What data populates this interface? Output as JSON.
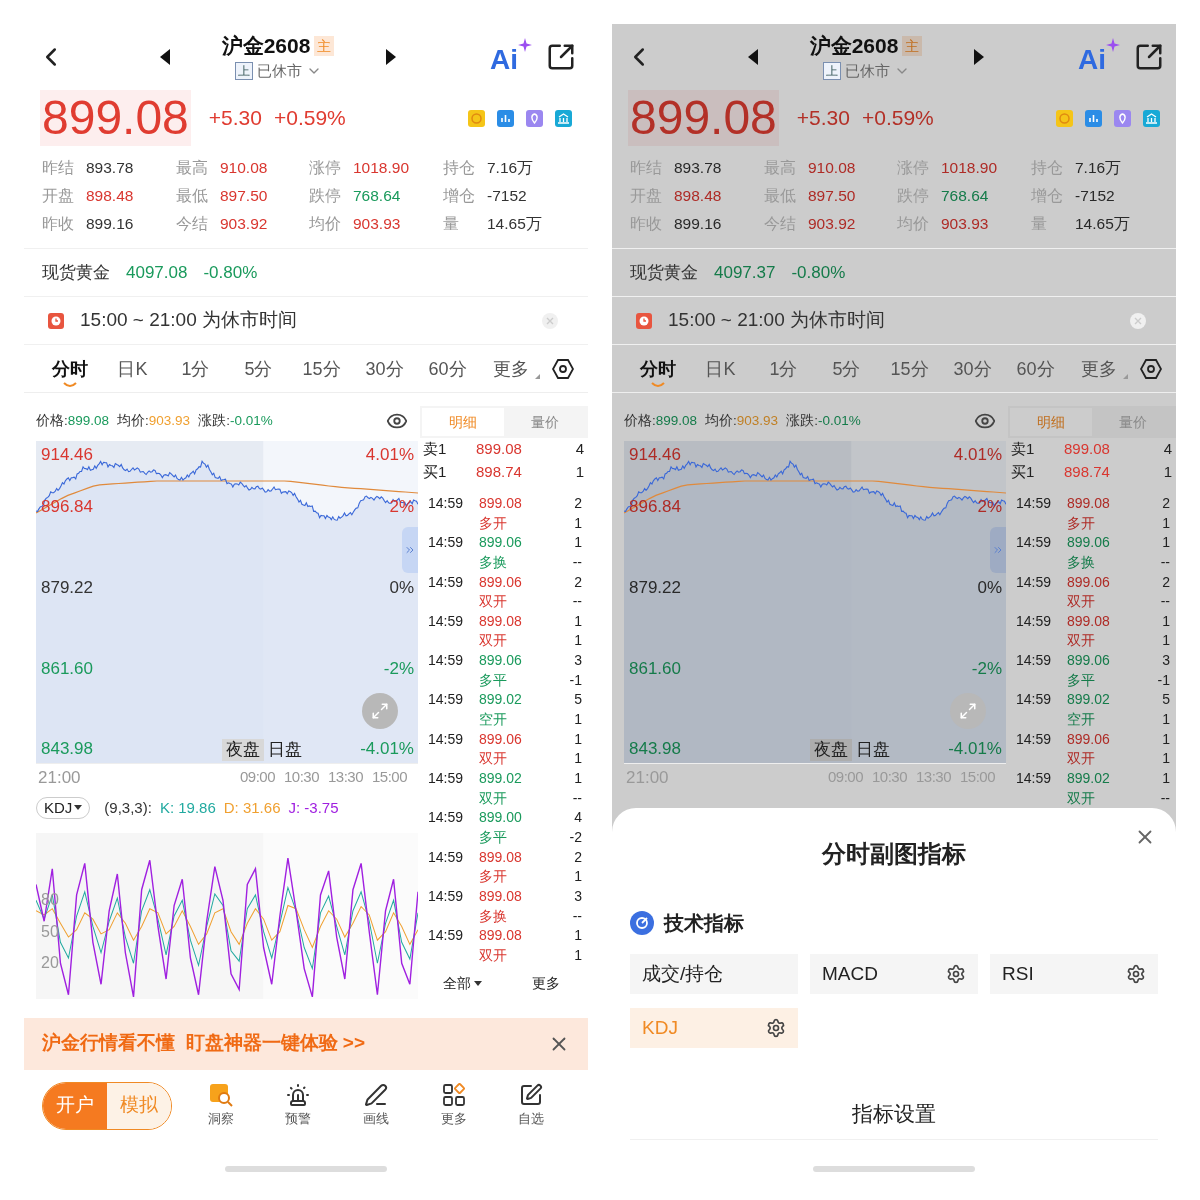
{
  "screens": [
    {
      "header": {
        "title": "沪金2608",
        "badge": "主",
        "exchange": "上",
        "status": "已休市",
        "ai_label": "Ai"
      },
      "quote": {
        "price": "899.08",
        "change": "+5.30",
        "change_pct": "+0.59%"
      },
      "stats": [
        {
          "label": "昨结",
          "value": "893.78",
          "color": "#333333"
        },
        {
          "label": "最高",
          "value": "910.08",
          "color": "#d9362f"
        },
        {
          "label": "涨停",
          "value": "1018.90",
          "color": "#d9362f"
        },
        {
          "label": "持仓",
          "value": "7.16万",
          "color": "#333333"
        },
        {
          "label": "开盘",
          "value": "898.48",
          "color": "#d9362f"
        },
        {
          "label": "最低",
          "value": "897.50",
          "color": "#d9362f"
        },
        {
          "label": "跌停",
          "value": "768.64",
          "color": "#1a9a5c"
        },
        {
          "label": "增仓",
          "value": "-7152",
          "color": "#333333"
        },
        {
          "label": "昨收",
          "value": "899.16",
          "color": "#333333"
        },
        {
          "label": "今结",
          "value": "903.92",
          "color": "#d9362f"
        },
        {
          "label": "均价",
          "value": "903.93",
          "color": "#d9362f"
        },
        {
          "label": "量",
          "value": "14.65万",
          "color": "#333333"
        }
      ],
      "spot": {
        "label": "现货黄金",
        "value": "4097.08",
        "change": "-0.80%"
      },
      "notice": {
        "text": "15:00 ~ 21:00 为休市时间"
      },
      "period_tabs": [
        {
          "label": "分时",
          "selected": true
        },
        {
          "label": "日K",
          "selected": false
        },
        {
          "label": "1分",
          "selected": false
        },
        {
          "label": "5分",
          "selected": false
        },
        {
          "label": "15分",
          "selected": false
        },
        {
          "label": "30分",
          "selected": false
        },
        {
          "label": "60分",
          "selected": false
        },
        {
          "label": "更多",
          "selected": false
        }
      ],
      "chart": {
        "legend": [
          {
            "label": "价格:",
            "value": "899.08",
            "color": "#1a9a5c"
          },
          {
            "label": "均价:",
            "value": "903.93",
            "color": "#f0a030"
          },
          {
            "label": "涨跌:",
            "value": "-0.01%",
            "color": "#1a9a5c"
          }
        ],
        "price_labels": [
          {
            "text": "914.46",
            "color": "#d9362f"
          },
          {
            "text": "896.84",
            "color": "#d9362f"
          },
          {
            "text": "879.22",
            "color": "#333333"
          },
          {
            "text": "861.60",
            "color": "#1a9a5c"
          },
          {
            "text": "843.98",
            "color": "#1a9a5c"
          }
        ],
        "pct_labels": [
          {
            "text": "4.01%",
            "color": "#d9362f"
          },
          {
            "text": "2%",
            "color": "#d9362f"
          },
          {
            "text": "0%",
            "color": "#333333"
          },
          {
            "text": "-2%",
            "color": "#1a9a5c"
          },
          {
            "text": "-4.01%",
            "color": "#1a9a5c"
          }
        ],
        "sessions": [
          {
            "label": "夜盘",
            "selected": true
          },
          {
            "label": "日盘",
            "selected": false
          }
        ],
        "time_labels": [
          "21:00",
          "09:00",
          "10:30",
          "13:30",
          "15:00"
        ]
      },
      "indicator": {
        "name": "KDJ",
        "params": "(9,3,3):",
        "values": [
          {
            "text": "K: 19.86",
            "color": "#22aaa0"
          },
          {
            "text": "D: 31.66",
            "color": "#f0a030"
          },
          {
            "text": "J: -3.75",
            "color": "#a020e0"
          }
        ],
        "chart_data": {
          "type": "line",
          "ylim": [
            -14,
            144
          ],
          "yticks": [
            80,
            50,
            20
          ],
          "series": [
            {
              "color": "#f0a030",
              "values": [
                70,
                66,
                72,
                58,
                45,
                52,
                68,
                62,
                48,
                52,
                68,
                58,
                42,
                55,
                72,
                68,
                48,
                55,
                70,
                55,
                38,
                48,
                68,
                72,
                50,
                38,
                58,
                72,
                62,
                42,
                50,
                75,
                72,
                52,
                35,
                55,
                70,
                62,
                45,
                58,
                74,
                66,
                42,
                50,
                68,
                55,
                38,
                52
              ]
            },
            {
              "color": "#22aaa0",
              "values": [
                80,
                62,
                85,
                40,
                25,
                65,
                88,
                55,
                30,
                60,
                82,
                45,
                20,
                70,
                90,
                62,
                28,
                65,
                80,
                42,
                18,
                55,
                86,
                75,
                32,
                22,
                72,
                85,
                50,
                25,
                58,
                92,
                70,
                35,
                15,
                68,
                84,
                55,
                28,
                70,
                88,
                60,
                20,
                58,
                80,
                40,
                24,
                68
              ]
            },
            {
              "color": "#a020e0",
              "values": [
                95,
                60,
                110,
                20,
                -10,
                85,
                115,
                40,
                0,
                70,
                105,
                30,
                -12,
                90,
                118,
                55,
                5,
                75,
                100,
                25,
                -10,
                60,
                112,
                80,
                10,
                -5,
                95,
                110,
                35,
                0,
                65,
                120,
                70,
                15,
                -12,
                85,
                108,
                45,
                5,
                90,
                115,
                50,
                -10,
                70,
                100,
                20,
                0,
                88
              ]
            }
          ]
        }
      },
      "trade_panel": {
        "tabs": [
          {
            "label": "明细",
            "selected": true
          },
          {
            "label": "量价",
            "selected": false
          }
        ],
        "quotes": [
          {
            "label": "卖1",
            "price": "899.08",
            "volume": "4"
          },
          {
            "label": "买1",
            "price": "898.74",
            "volume": "1"
          }
        ],
        "trades": [
          {
            "time": "14:59",
            "price": "899.08",
            "volume": "2",
            "type": "多开",
            "change": "1",
            "color": "#d9362f"
          },
          {
            "time": "14:59",
            "price": "899.06",
            "volume": "1",
            "type": "多换",
            "change": "--",
            "color": "#1a9a5c"
          },
          {
            "time": "14:59",
            "price": "899.06",
            "volume": "2",
            "type": "双开",
            "change": "--",
            "color": "#d9362f"
          },
          {
            "time": "14:59",
            "price": "899.08",
            "volume": "1",
            "type": "双开",
            "change": "1",
            "color": "#d9362f"
          },
          {
            "time": "14:59",
            "price": "899.06",
            "volume": "3",
            "type": "多平",
            "change": "-1",
            "color": "#1a9a5c"
          },
          {
            "time": "14:59",
            "price": "899.02",
            "volume": "5",
            "type": "空开",
            "change": "1",
            "color": "#1a9a5c"
          },
          {
            "time": "14:59",
            "price": "899.06",
            "volume": "1",
            "type": "双开",
            "change": "1",
            "color": "#d9362f"
          },
          {
            "time": "14:59",
            "price": "899.02",
            "volume": "1",
            "type": "双开",
            "change": "--",
            "color": "#1a9a5c"
          },
          {
            "time": "14:59",
            "price": "899.00",
            "volume": "4",
            "type": "多平",
            "change": "-2",
            "color": "#1a9a5c"
          },
          {
            "time": "14:59",
            "price": "899.08",
            "volume": "2",
            "type": "多开",
            "change": "1",
            "color": "#d9362f"
          },
          {
            "time": "14:59",
            "price": "899.08",
            "volume": "3",
            "type": "多换",
            "change": "--",
            "color": "#d9362f"
          },
          {
            "time": "14:59",
            "price": "899.08",
            "volume": "1",
            "type": "双开",
            "change": "1",
            "color": "#d9362f"
          }
        ],
        "footer": {
          "filter": "全部",
          "more": "更多"
        }
      },
      "banner": {
        "text": "沪金行情看不懂  盯盘神器一键体验 >>"
      },
      "bottom_bar": {
        "account": [
          {
            "label": "开户",
            "selected": true
          },
          {
            "label": "模拟",
            "selected": false
          }
        ],
        "tools": [
          {
            "label": "洞察",
            "kind": "insight"
          },
          {
            "label": "预警",
            "kind": "alert"
          },
          {
            "label": "画线",
            "kind": "draw"
          },
          {
            "label": "更多",
            "kind": "more"
          },
          {
            "label": "自选",
            "kind": "watch"
          }
        ]
      }
    },
    {
      "dimmed": true,
      "header": {
        "title": "沪金2608",
        "badge": "主",
        "exchange": "上",
        "status": "已休市",
        "ai_label": "Ai"
      },
      "quote": {
        "price": "899.08",
        "change": "+5.30",
        "change_pct": "+0.59%"
      },
      "stats": [
        {
          "label": "昨结",
          "value": "893.78",
          "color": "#292929"
        },
        {
          "label": "最高",
          "value": "910.08",
          "color": "#ae2b26"
        },
        {
          "label": "涨停",
          "value": "1018.90",
          "color": "#ae2b26"
        },
        {
          "label": "持仓",
          "value": "7.16万",
          "color": "#292929"
        },
        {
          "label": "开盘",
          "value": "898.48",
          "color": "#ae2b26"
        },
        {
          "label": "最低",
          "value": "897.50",
          "color": "#ae2b26"
        },
        {
          "label": "跌停",
          "value": "768.64",
          "color": "#157b4a"
        },
        {
          "label": "增仓",
          "value": "-7152",
          "color": "#292929"
        },
        {
          "label": "昨收",
          "value": "899.16",
          "color": "#292929"
        },
        {
          "label": "今结",
          "value": "903.92",
          "color": "#ae2b26"
        },
        {
          "label": "均价",
          "value": "903.93",
          "color": "#ae2b26"
        },
        {
          "label": "量",
          "value": "14.65万",
          "color": "#292929"
        }
      ],
      "spot": {
        "label": "现货黄金",
        "value": "4097.37",
        "change": "-0.80%"
      },
      "notice": {
        "text": "15:00 ~ 21:00 为休市时间"
      },
      "period_tabs": [
        {
          "label": "分时",
          "selected": true
        },
        {
          "label": "日K",
          "selected": false
        },
        {
          "label": "1分",
          "selected": false
        },
        {
          "label": "5分",
          "selected": false
        },
        {
          "label": "15分",
          "selected": false
        },
        {
          "label": "30分",
          "selected": false
        },
        {
          "label": "60分",
          "selected": false
        },
        {
          "label": "更多",
          "selected": false
        }
      ],
      "chart": {
        "legend": [
          {
            "label": "价格:",
            "value": "899.08",
            "color": "#157b4a"
          },
          {
            "label": "均价:",
            "value": "903.93",
            "color": "#c08026"
          },
          {
            "label": "涨跌:",
            "value": "-0.01%",
            "color": "#157b4a"
          }
        ],
        "price_labels": [
          {
            "text": "914.46",
            "color": "#ae2b26"
          },
          {
            "text": "896.84",
            "color": "#ae2b26"
          },
          {
            "text": "879.22",
            "color": "#292929"
          },
          {
            "text": "861.60",
            "color": "#157b4a"
          },
          {
            "text": "843.98",
            "color": "#157b4a"
          }
        ],
        "pct_labels": [
          {
            "text": "4.01%",
            "color": "#ae2b26"
          },
          {
            "text": "2%",
            "color": "#ae2b26"
          },
          {
            "text": "0%",
            "color": "#292929"
          },
          {
            "text": "-2%",
            "color": "#157b4a"
          },
          {
            "text": "-4.01%",
            "color": "#157b4a"
          }
        ],
        "sessions": [
          {
            "label": "夜盘",
            "selected": true
          },
          {
            "label": "日盘",
            "selected": false
          }
        ],
        "time_labels": [
          "21:00",
          "09:00",
          "10:30",
          "13:30",
          "15:00"
        ]
      },
      "trade_panel": {
        "tabs": [
          {
            "label": "明细",
            "selected": true
          },
          {
            "label": "量价",
            "selected": false
          }
        ],
        "quotes": [
          {
            "label": "卖1",
            "price": "899.08",
            "volume": "4"
          },
          {
            "label": "买1",
            "price": "898.74",
            "volume": "1"
          }
        ],
        "trades": [
          {
            "time": "14:59",
            "price": "899.08",
            "volume": "2",
            "type": "多开",
            "change": "1",
            "color": "#ae2b26"
          },
          {
            "time": "14:59",
            "price": "899.06",
            "volume": "1",
            "type": "多换",
            "change": "--",
            "color": "#157b4a"
          },
          {
            "time": "14:59",
            "price": "899.06",
            "volume": "2",
            "type": "双开",
            "change": "--",
            "color": "#ae2b26"
          },
          {
            "time": "14:59",
            "price": "899.08",
            "volume": "1",
            "type": "双开",
            "change": "1",
            "color": "#ae2b26"
          },
          {
            "time": "14:59",
            "price": "899.06",
            "volume": "3",
            "type": "多平",
            "change": "-1",
            "color": "#157b4a"
          },
          {
            "time": "14:59",
            "price": "899.02",
            "volume": "5",
            "type": "空开",
            "change": "1",
            "color": "#157b4a"
          },
          {
            "time": "14:59",
            "price": "899.06",
            "volume": "1",
            "type": "双开",
            "change": "1",
            "color": "#ae2b26"
          },
          {
            "time": "14:59",
            "price": "899.02",
            "volume": "1",
            "type": "双开",
            "change": "--",
            "color": "#157b4a"
          }
        ]
      },
      "sheet": {
        "title": "分时副图指标",
        "section": "技术指标",
        "options": [
          {
            "label": "成交/持仓",
            "selected": false,
            "settings": false
          },
          {
            "label": "MACD",
            "selected": false,
            "settings": true
          },
          {
            "label": "RSI",
            "selected": false,
            "settings": true
          },
          {
            "label": "KDJ",
            "selected": true,
            "settings": true
          }
        ],
        "settings_button": "指标设置"
      }
    }
  ]
}
